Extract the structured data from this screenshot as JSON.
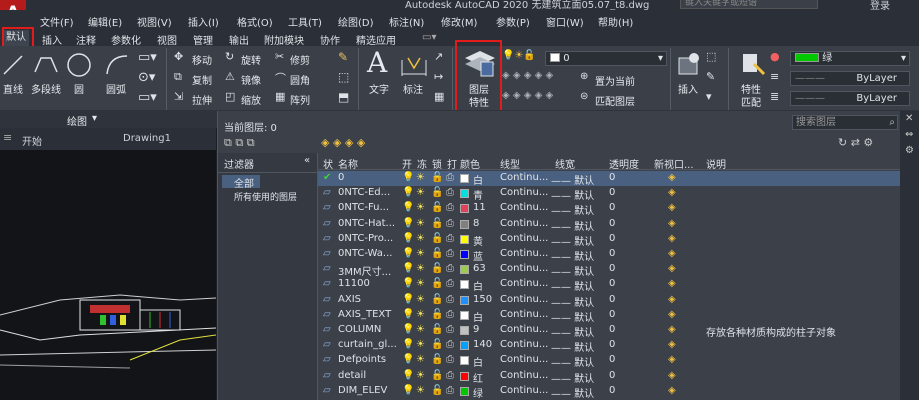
{
  "title": "Autodesk AutoCAD 2020 无建筑立面05.07_t8.dwg",
  "search_placeholder": "键入关键字或短语",
  "login": "登录",
  "logo": "A",
  "menu": [
    "文件(F)",
    "编辑(E)",
    "视图(V)",
    "插入(I)",
    "格式(O)",
    "工具(T)",
    "绘图(D)",
    "标注(N)",
    "修改(M)",
    "参数(P)",
    "窗口(W)",
    "帮助(H)"
  ],
  "ribbon_tabs": [
    "默认",
    "插入",
    "注释",
    "参数化",
    "视图",
    "管理",
    "输出",
    "附加模块",
    "协作",
    "精选应用"
  ],
  "draw_panel": {
    "line": "直线",
    "polyline": "多段线",
    "circle": "圆",
    "arc": "圆弧",
    "group_label": "绘图"
  },
  "modify_panel": {
    "move": "移动",
    "rotate": "旋转",
    "trim": "修剪",
    "copy": "复制",
    "mirror": "镜像",
    "fillet": "圆角",
    "stretch": "拉伸",
    "scale": "缩放",
    "array": "阵列"
  },
  "annotation_panel": {
    "text": "文字",
    "dimension": "标注"
  },
  "layer_panel": {
    "layer_props_line1": "图层",
    "layer_props_line2": "特性",
    "current_layer": "0",
    "set_current": "置为当前",
    "match_layer": "匹配图层"
  },
  "insert_panel": {
    "insert": "插入"
  },
  "properties_panel": {
    "match_line1": "特性",
    "match_line2": "匹配",
    "color": "绿",
    "color_hex": "#00c800",
    "linetype": "ByLayer",
    "lineweight": "ByLayer"
  },
  "file_tabs": [
    "开始",
    "Drawing1"
  ],
  "layer_manager": {
    "current_layer_label": "当前图层: 0",
    "search_placeholder": "搜索图层",
    "filters_header": "过滤器",
    "filter_all": "全部",
    "filter_used": "所有使用的图层",
    "columns": [
      "状",
      "名称",
      "开",
      "冻",
      "锁",
      "打",
      "颜色",
      "线型",
      "线宽",
      "透明度",
      "新视口...",
      "说明"
    ],
    "rows": [
      {
        "name": "0",
        "color_name": "白",
        "color": "#ffffff",
        "linetype": "Continu...",
        "lineweight": "—— 默认",
        "transparency": "0",
        "description": "",
        "current": true
      },
      {
        "name": "0NTC-Ed...",
        "color_name": "青",
        "color": "#00e0e0",
        "linetype": "Continu...",
        "lineweight": "—— 默认",
        "transparency": "0",
        "description": ""
      },
      {
        "name": "0NTC-Fu...",
        "color_name": "11",
        "color": "#e0405a",
        "linetype": "Continu...",
        "lineweight": "—— 默认",
        "transparency": "0",
        "description": ""
      },
      {
        "name": "0NTC-Hat...",
        "color_name": "8",
        "color": "#808080",
        "linetype": "Continu...",
        "lineweight": "—— 默认",
        "transparency": "0",
        "description": ""
      },
      {
        "name": "0NTC-Pro...",
        "color_name": "黄",
        "color": "#ffff00",
        "linetype": "Continu...",
        "lineweight": "—— 默认",
        "transparency": "0",
        "description": ""
      },
      {
        "name": "0NTC-Wa...",
        "color_name": "蓝",
        "color": "#0000ff",
        "linetype": "Continu...",
        "lineweight": "—— 默认",
        "transparency": "0",
        "description": ""
      },
      {
        "name": "3MM尺寸...",
        "color_name": "63",
        "color": "#9ccc4c",
        "linetype": "Continu...",
        "lineweight": "—— 默认",
        "transparency": "0",
        "description": ""
      },
      {
        "name": "11100",
        "color_name": "白",
        "color": "#ffffff",
        "linetype": "Continu...",
        "lineweight": "—— 默认",
        "transparency": "0",
        "description": ""
      },
      {
        "name": "AXIS",
        "color_name": "150",
        "color": "#1e90ff",
        "linetype": "Continu...",
        "lineweight": "—— 默认",
        "transparency": "0",
        "description": ""
      },
      {
        "name": "AXIS_TEXT",
        "color_name": "白",
        "color": "#ffffff",
        "linetype": "Continu...",
        "lineweight": "—— 默认",
        "transparency": "0",
        "description": ""
      },
      {
        "name": "COLUMN",
        "color_name": "9",
        "color": "#c0c0c0",
        "linetype": "Continu...",
        "lineweight": "—— 默认",
        "transparency": "0",
        "description": "存放各种材质构成的柱子对象"
      },
      {
        "name": "curtain_gl...",
        "color_name": "140",
        "color": "#00a0ff",
        "linetype": "Continu...",
        "lineweight": "—— 默认",
        "transparency": "0",
        "description": ""
      },
      {
        "name": "Defpoints",
        "color_name": "白",
        "color": "#ffffff",
        "linetype": "Continu...",
        "lineweight": "—— 默认",
        "transparency": "0",
        "description": ""
      },
      {
        "name": "detail",
        "color_name": "红",
        "color": "#ff0000",
        "linetype": "Continu...",
        "lineweight": "—— 默认",
        "transparency": "0",
        "description": ""
      },
      {
        "name": "DIM_ELEV",
        "color_name": "绿",
        "color": "#00c800",
        "linetype": "Continu...",
        "lineweight": "—— 默认",
        "transparency": "0",
        "description": ""
      }
    ]
  }
}
